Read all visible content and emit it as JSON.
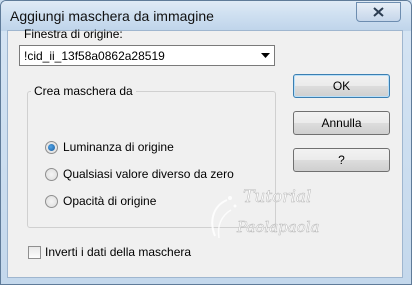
{
  "window": {
    "title": "Aggiungi maschera da immagine"
  },
  "source": {
    "label": "Finestra di origine:",
    "selected": "!cid_ii_13f58a0862a28519"
  },
  "buttons": {
    "ok": "OK",
    "cancel": "Annulla",
    "help": "?"
  },
  "mask_group": {
    "title": "Crea maschera da",
    "options": [
      {
        "label": "Luminanza di origine",
        "selected": true
      },
      {
        "label": "Qualsiasi valore diverso da zero",
        "selected": false
      },
      {
        "label": "Opacità di origine",
        "selected": false
      }
    ]
  },
  "invert": {
    "label": "Inverti i dati della maschera",
    "checked": false
  },
  "watermark": {
    "line1": "Tutorial",
    "line2": "Paolapaola"
  },
  "icons": {
    "close": "close-icon",
    "dropdown": "chevron-down-icon"
  }
}
